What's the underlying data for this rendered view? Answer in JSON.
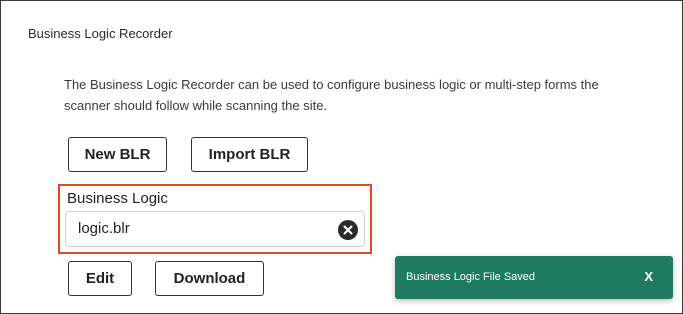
{
  "section": {
    "title": "Business Logic Recorder",
    "description": "The Business Logic Recorder can be used to configure business logic or multi-step forms the scanner should follow while scanning the site."
  },
  "buttons": {
    "new_label": "New BLR",
    "import_label": "Import BLR",
    "edit_label": "Edit",
    "download_label": "Download"
  },
  "business_logic": {
    "label": "Business Logic",
    "value": "logic.blr",
    "clear_icon": "clear-circle-x-icon"
  },
  "toast": {
    "message": "Business Logic File Saved",
    "close_label": "X",
    "color": "#1e7a60"
  },
  "colors": {
    "highlight": "#e0492a"
  }
}
